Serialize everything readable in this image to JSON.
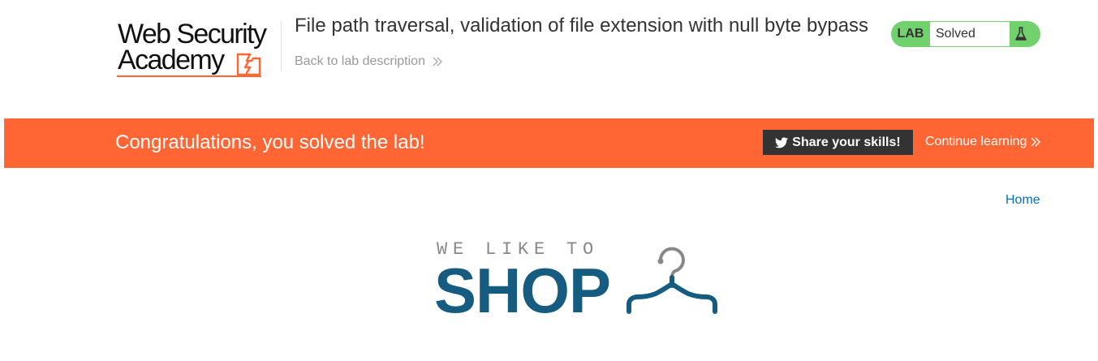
{
  "header": {
    "logo": {
      "line1": "Web Security",
      "line2": "Academy",
      "accent_color": "#ff6633"
    },
    "lab_title": "File path traversal, validation of file extension with null byte bypass",
    "back_link": "Back to lab description",
    "lab_status": {
      "label": "LAB",
      "value": "Solved",
      "color": "#70d16d",
      "icon": "flask-icon"
    }
  },
  "banner": {
    "message": "Congratulations, you solved the lab!",
    "share_button": "Share your skills!",
    "share_icon": "twitter-icon",
    "continue_link": "Continue learning",
    "color": "#ff6633"
  },
  "nav": {
    "home": "Home"
  },
  "shop_logo": {
    "tagline": "WE LIKE TO",
    "word": "SHOP",
    "color": "#165c80",
    "icon": "hanger-icon"
  }
}
